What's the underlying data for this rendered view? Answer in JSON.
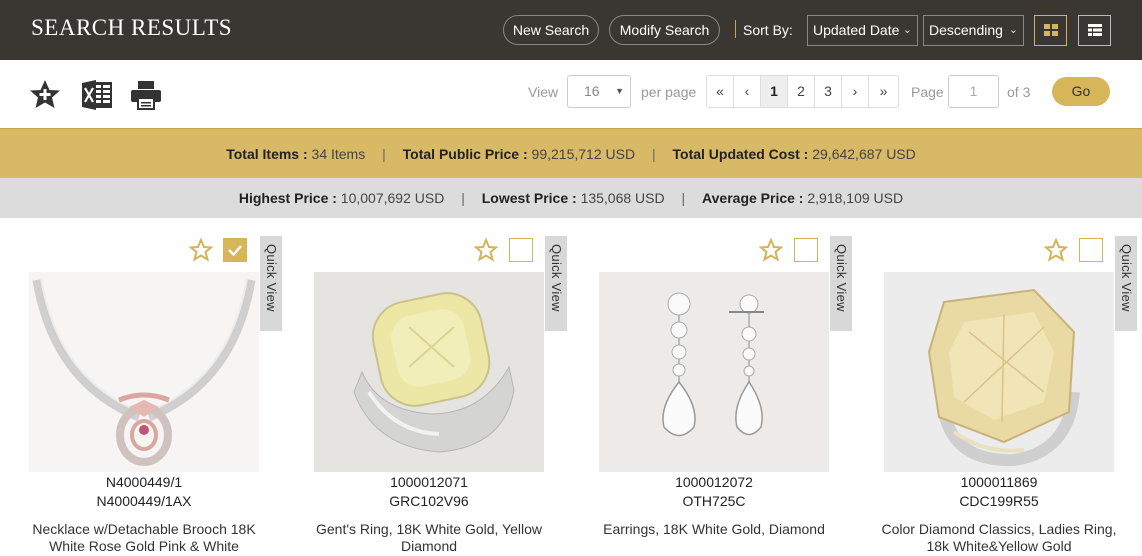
{
  "header": {
    "title": "SEARCH RESULTS",
    "new_search": "New Search",
    "modify_search": "Modify Search",
    "sort_by_label": "Sort By:",
    "sort_field": "Updated Date",
    "sort_order": "Descending"
  },
  "toolbar": {
    "view_label": "View",
    "per_page_value": "16",
    "per_page_label": "per page",
    "pager": [
      "«",
      "‹",
      "1",
      "2",
      "3",
      "›",
      "»"
    ],
    "current_page": "1",
    "page_label": "Page",
    "page_input_placeholder": "1",
    "of_label": "of 3",
    "go_label": "Go"
  },
  "summary": {
    "total_items_label": "Total Items :",
    "total_items_value": "34 Items",
    "total_public_label": "Total Public Price :",
    "total_public_value": "99,215,712 USD",
    "total_cost_label": "Total Updated Cost :",
    "total_cost_value": "29,642,687 USD",
    "highest_label": "Highest Price :",
    "highest_value": "10,007,692 USD",
    "lowest_label": "Lowest Price :",
    "lowest_value": "135,068 USD",
    "average_label": "Average Price :",
    "average_value": "2,918,109 USD",
    "separator": "|"
  },
  "products": [
    {
      "code1": "N4000449/1",
      "code2": "N4000449/1AX",
      "desc": "Necklace w/Detachable Brooch 18K White Rose Gold Pink & White",
      "quick_view": "Quick View",
      "checked": true
    },
    {
      "code1": "1000012071",
      "code2": "GRC102V96",
      "desc": "Gent's Ring, 18K White Gold, Yellow Diamond",
      "quick_view": "Quick View",
      "checked": false
    },
    {
      "code1": "1000012072",
      "code2": "OTH725C",
      "desc": "Earrings, 18K White Gold, Diamond",
      "quick_view": "Quick View",
      "checked": false
    },
    {
      "code1": "1000011869",
      "code2": "CDC199R55",
      "desc": "Color Diamond Classics, Ladies Ring, 18k White&Yellow Gold",
      "quick_view": "Quick View",
      "checked": false
    }
  ],
  "colors": {
    "header_bg": "#3a3733",
    "accent_gold": "#d6b658",
    "band_gold": "#d8b966",
    "band_gray": "#dcdcdc"
  },
  "icons": [
    "favorites-star-icon",
    "excel-export-icon",
    "print-icon",
    "grid-view-icon",
    "list-view-icon",
    "star-icon",
    "checkbox-icon"
  ]
}
